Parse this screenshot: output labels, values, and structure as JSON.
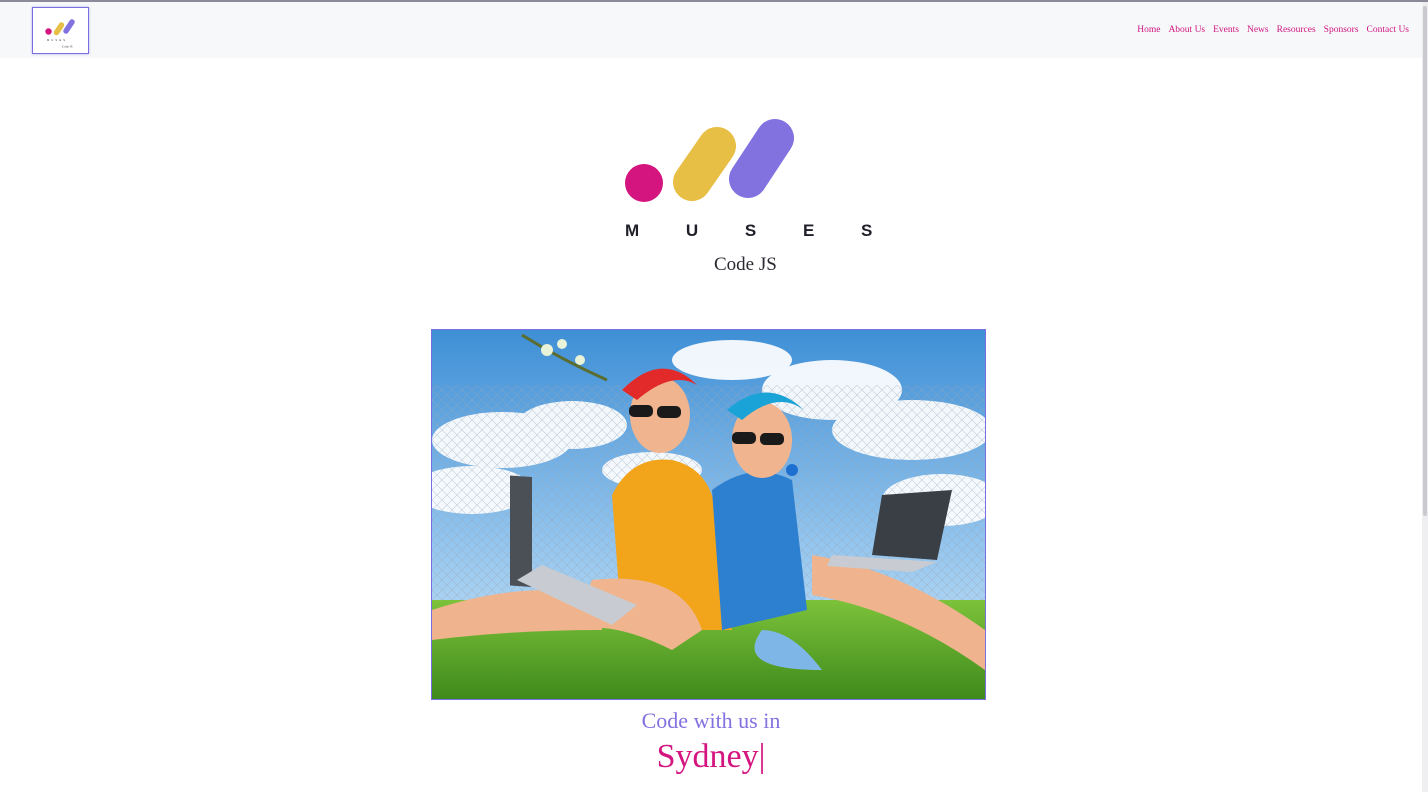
{
  "nav": {
    "logo_alt": "Muses Code JS logo",
    "links": [
      "Home",
      "About Us",
      "Events",
      "News",
      "Resources",
      "Sponsors",
      "Contact Us"
    ]
  },
  "hero": {
    "wordmark": "M U S E S",
    "subtitle": "Code JS"
  },
  "photo": {
    "description_icon": "two-women-with-laptops-image"
  },
  "tagline": {
    "prefix": "Code with us in",
    "city": "Sydney",
    "cursor": "|"
  },
  "colors": {
    "brand_magenta": "#d4147f",
    "brand_yellow": "#e8bf45",
    "brand_purple": "#8272e0"
  }
}
